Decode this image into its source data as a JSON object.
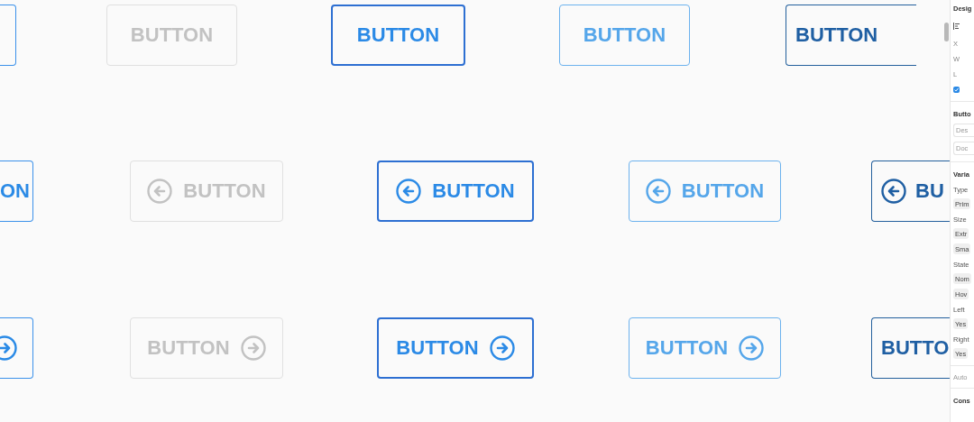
{
  "canvas": {
    "rows": [
      {
        "buttons": [
          {
            "kind": "plain"
          },
          {
            "kind": "plain",
            "text": "BUTTON"
          },
          {
            "kind": "plain",
            "text": "BUTTON"
          },
          {
            "kind": "plain",
            "text": "BUTTON"
          },
          {
            "kind": "plain",
            "text": "BUTTON"
          }
        ]
      },
      {
        "buttons": [
          {
            "kind": "plain",
            "text": "ON"
          },
          {
            "kind": "lefticon",
            "text": "BUTTON"
          },
          {
            "kind": "lefticon",
            "text": "BUTTON"
          },
          {
            "kind": "lefticon",
            "text": "BUTTON"
          },
          {
            "kind": "lefticon",
            "text": "BU"
          }
        ]
      },
      {
        "buttons": [
          {
            "kind": "righticon"
          },
          {
            "kind": "righticon",
            "text": "BUTTON"
          },
          {
            "kind": "righticon",
            "text": "BUTTON"
          },
          {
            "kind": "righticon",
            "text": "BUTTON"
          },
          {
            "kind": "plain",
            "text": "BUTTO"
          }
        ]
      }
    ]
  },
  "panel": {
    "items": [
      {
        "kind": "heading",
        "text": "Desig"
      },
      {
        "kind": "align"
      },
      {
        "kind": "field",
        "text": "X"
      },
      {
        "kind": "field",
        "text": "W"
      },
      {
        "kind": "field",
        "text": "L"
      },
      {
        "kind": "checkbox",
        "checked": true
      },
      {
        "kind": "divider"
      },
      {
        "kind": "heading",
        "text": "Butto"
      },
      {
        "kind": "input",
        "placeholder": "Des"
      },
      {
        "kind": "input",
        "placeholder": "Doc"
      },
      {
        "kind": "divider"
      },
      {
        "kind": "heading",
        "text": "Varia"
      },
      {
        "kind": "label",
        "text": "Type"
      },
      {
        "kind": "chip",
        "text": "Prim"
      },
      {
        "kind": "label",
        "text": "Size"
      },
      {
        "kind": "chip",
        "text": "Extr"
      },
      {
        "kind": "chip",
        "text": "Sma"
      },
      {
        "kind": "label",
        "text": "State"
      },
      {
        "kind": "chip",
        "text": "Nom"
      },
      {
        "kind": "chip",
        "text": "Hov"
      },
      {
        "kind": "label",
        "text": "Left"
      },
      {
        "kind": "chip",
        "text": "Yes"
      },
      {
        "kind": "label",
        "text": "Right"
      },
      {
        "kind": "chip",
        "text": "Yes"
      },
      {
        "kind": "divider"
      },
      {
        "kind": "muted",
        "text": "Auto"
      },
      {
        "kind": "divider"
      },
      {
        "kind": "heading",
        "text": "Cons"
      }
    ]
  }
}
